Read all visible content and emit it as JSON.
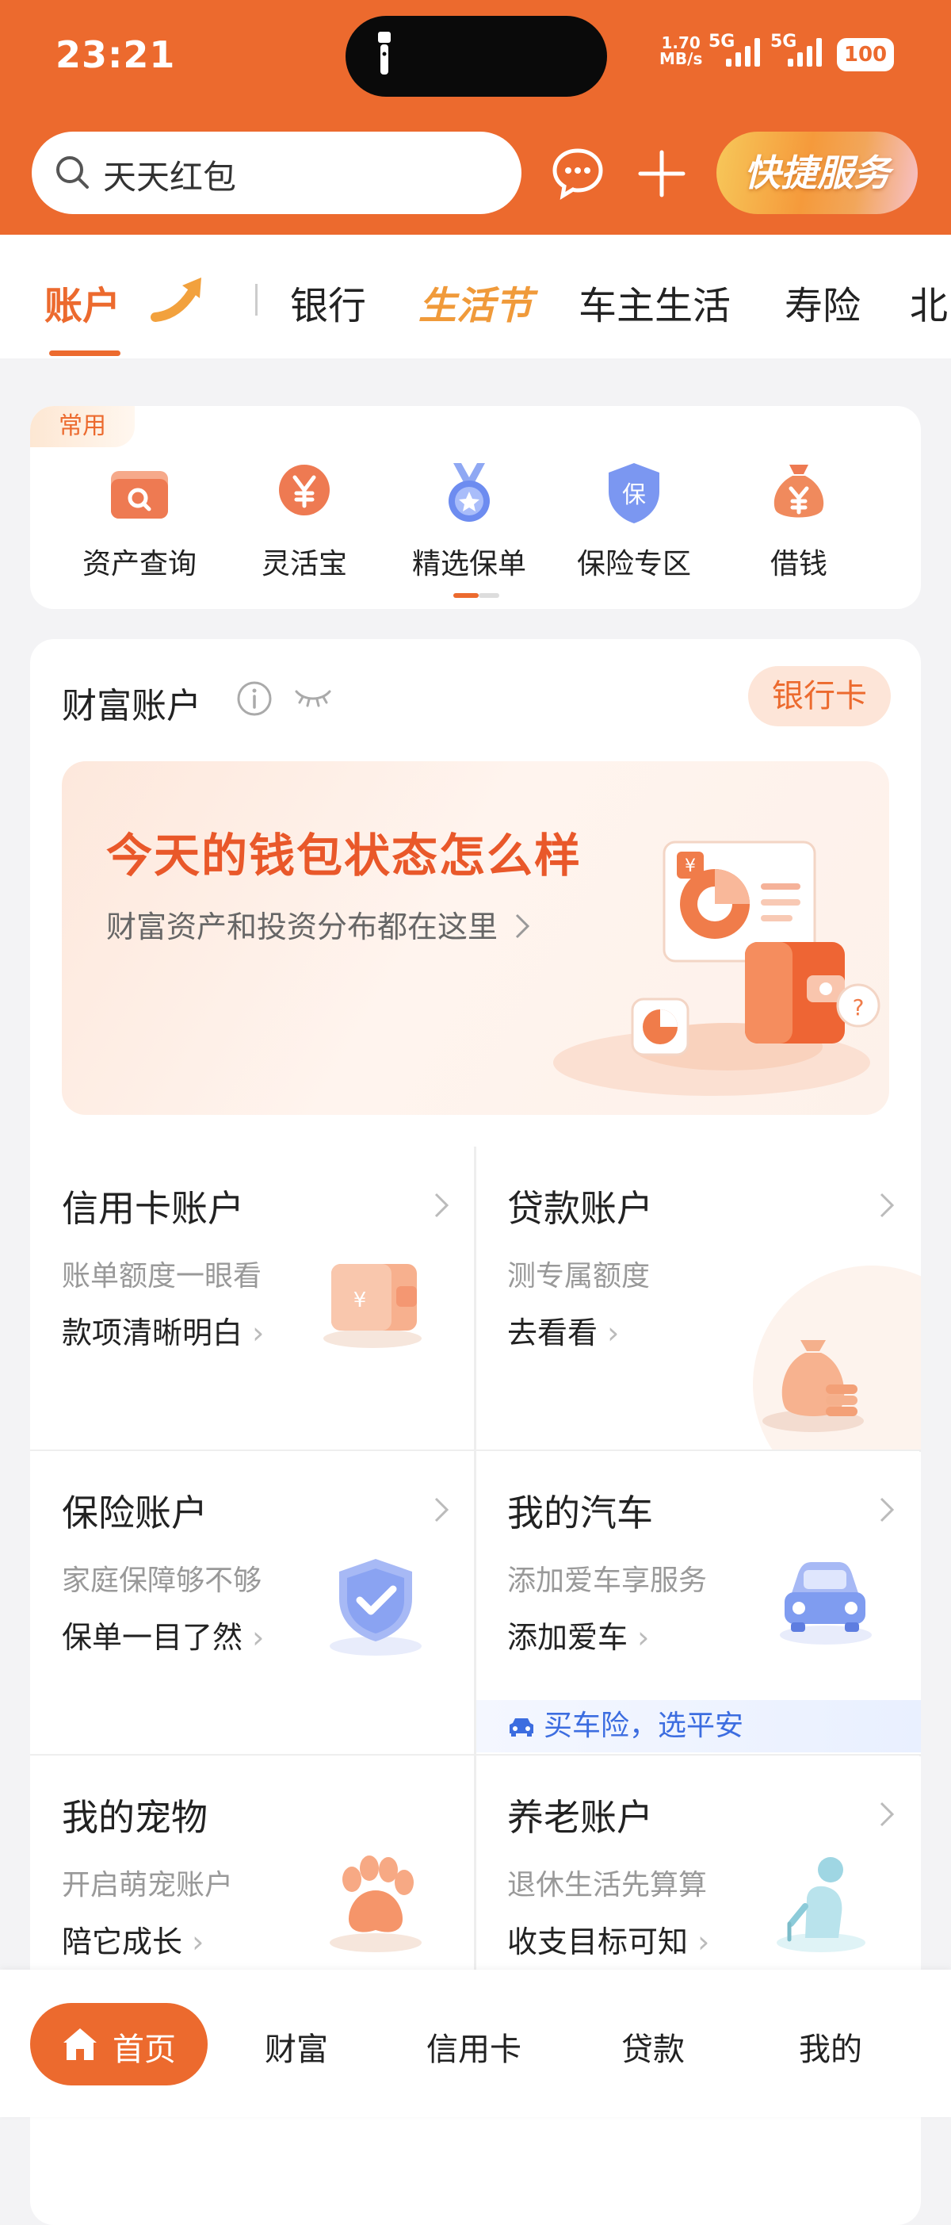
{
  "status_bar": {
    "time": "23:21",
    "net_speed_top": "1.70",
    "net_speed_unit": "MB/s",
    "sig1": "5G",
    "sig2": "5G",
    "battery": "100"
  },
  "header": {
    "search_placeholder": "天天红包",
    "quick_service_label": "快捷服务"
  },
  "tabs": [
    {
      "label": "账户"
    },
    {
      "label": "银行"
    },
    {
      "label": "生活节"
    },
    {
      "label": "车主生活"
    },
    {
      "label": "寿险"
    },
    {
      "label": "北"
    }
  ],
  "common": {
    "tag": "常用",
    "items": [
      {
        "label": "资产查询",
        "icon": "asset-query-icon"
      },
      {
        "label": "灵活宝",
        "icon": "yuan-coin-icon"
      },
      {
        "label": "精选保单",
        "icon": "medal-icon"
      },
      {
        "label": "保险专区",
        "icon": "shield-bao-icon"
      },
      {
        "label": "借钱",
        "icon": "money-bag-icon"
      }
    ]
  },
  "wealth": {
    "title": "财富账户",
    "bank_card_label": "银行卡",
    "banner_title": "今天的钱包状态怎么样",
    "banner_subtitle": "财富资产和投资分布都在这里"
  },
  "accounts": [
    {
      "title": "信用卡账户",
      "desc": "账单额度一眼看",
      "link": "款项清晰明白"
    },
    {
      "title": "贷款账户",
      "desc": "测专属额度",
      "link": "去看看"
    },
    {
      "title": "保险账户",
      "desc": "家庭保障够不够",
      "link": "保单一目了然"
    },
    {
      "title": "我的汽车",
      "desc": "添加爱车享服务",
      "link": "添加爱车",
      "promo": "买车险，选平安"
    },
    {
      "title": "我的宠物",
      "desc": "开启萌宠账户",
      "link": "陪它成长"
    },
    {
      "title": "养老账户",
      "desc": "退休生活先算算",
      "link": "收支目标可知"
    }
  ],
  "bottom_nav": [
    {
      "label": "首页"
    },
    {
      "label": "财富"
    },
    {
      "label": "信用卡"
    },
    {
      "label": "贷款"
    },
    {
      "label": "我的"
    }
  ],
  "colors": {
    "brand": "#ec6a2e",
    "festival": "#f09a3a",
    "car_promo": "#3c6de0"
  }
}
